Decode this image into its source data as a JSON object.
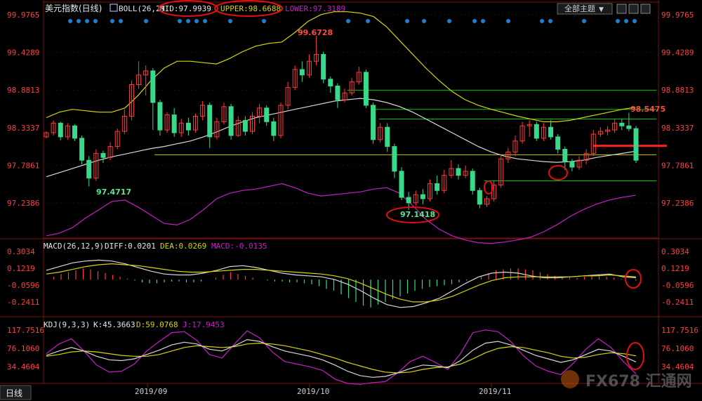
{
  "header": {
    "symbol": "美元指数",
    "period": "(日线)",
    "indicator": "BOLL(26,2)",
    "mid": "MID:97.9939",
    "upper": "UPPER:98.6688",
    "lower": "LOWER:97.3189",
    "theme_button": "全部主题"
  },
  "footer": {
    "tab": "日线"
  },
  "watermark": "FX678 汇通网",
  "colors": {
    "up": "#ff3b3b",
    "down": "#39d98a",
    "mid": "#d8d8d8",
    "upper": "#d6d600",
    "lower": "#c81ec8",
    "axis": "#ff4040",
    "level": "#c8c800",
    "support": "#00c800"
  },
  "chart_data": [
    {
      "type": "candlestick",
      "title": "美元指数(日线)",
      "indicator": "BOLL(26,2)",
      "yticks": [
        "99.9765",
        "99.4289",
        "98.8813",
        "98.3337",
        "97.7861",
        "97.2386"
      ],
      "ylim": [
        96.8,
        100.04
      ],
      "xticks": [
        "2019/09",
        "2019/10",
        "2019/11"
      ],
      "annotations": [
        {
          "text": "99.6728",
          "kind": "high"
        },
        {
          "text": "97.4717",
          "kind": "low"
        },
        {
          "text": "97.1418",
          "kind": "low"
        },
        {
          "text": "98.5475",
          "kind": "high"
        }
      ],
      "candles": [
        [
          98.2,
          98.26,
          98.28,
          98.18
        ],
        [
          98.26,
          98.4,
          98.44,
          98.22
        ],
        [
          98.4,
          98.2,
          98.42,
          98.15
        ],
        [
          98.2,
          98.36,
          98.4,
          98.16
        ],
        [
          98.36,
          98.18,
          98.38,
          98.14
        ],
        [
          98.18,
          97.86,
          98.22,
          97.8
        ],
        [
          97.86,
          97.6,
          97.92,
          97.48
        ],
        [
          97.6,
          97.96,
          98.02,
          97.56
        ],
        [
          97.96,
          97.9,
          98.0,
          97.82
        ],
        [
          97.9,
          98.06,
          98.12,
          97.86
        ],
        [
          98.06,
          98.28,
          98.32,
          98.02
        ],
        [
          98.28,
          98.5,
          98.6,
          98.24
        ],
        [
          98.5,
          98.96,
          99.02,
          98.44
        ],
        [
          98.96,
          99.1,
          99.3,
          98.9
        ],
        [
          99.1,
          99.16,
          99.24,
          98.8
        ],
        [
          99.16,
          98.7,
          99.2,
          98.3
        ],
        [
          98.7,
          98.3,
          98.74,
          98.22
        ],
        [
          98.3,
          98.52,
          98.56,
          98.26
        ],
        [
          98.52,
          98.26,
          98.62,
          98.2
        ],
        [
          98.26,
          98.4,
          98.46,
          98.2
        ],
        [
          98.4,
          98.3,
          98.48,
          98.22
        ],
        [
          98.3,
          98.5,
          98.54,
          98.26
        ],
        [
          98.5,
          98.66,
          98.72,
          98.44
        ],
        [
          98.66,
          98.2,
          98.7,
          98.04
        ],
        [
          98.2,
          98.42,
          98.48,
          98.16
        ],
        [
          98.42,
          98.64,
          98.7,
          98.38
        ],
        [
          98.64,
          98.22,
          98.68,
          98.16
        ],
        [
          98.22,
          98.44,
          98.5,
          98.2
        ],
        [
          98.44,
          98.28,
          98.5,
          98.22
        ],
        [
          98.28,
          98.5,
          98.56,
          98.24
        ],
        [
          98.5,
          98.62,
          98.68,
          98.4
        ],
        [
          98.62,
          98.42,
          98.66,
          98.36
        ],
        [
          98.42,
          98.22,
          98.48,
          98.14
        ],
        [
          98.22,
          98.66,
          98.7,
          98.18
        ],
        [
          98.66,
          98.92,
          99.0,
          98.6
        ],
        [
          98.92,
          99.18,
          99.24,
          98.88
        ],
        [
          99.18,
          99.1,
          99.3,
          99.0
        ],
        [
          99.1,
          99.3,
          99.4,
          99.06
        ],
        [
          99.3,
          99.4,
          99.67,
          99.24
        ],
        [
          99.4,
          99.04,
          99.44,
          98.98
        ],
        [
          99.04,
          98.94,
          99.08,
          98.84
        ],
        [
          98.94,
          98.74,
          98.98,
          98.62
        ],
        [
          98.74,
          98.84,
          98.9,
          98.7
        ],
        [
          98.84,
          99.0,
          99.06,
          98.8
        ],
        [
          99.0,
          99.14,
          99.22,
          98.96
        ],
        [
          99.14,
          98.66,
          99.18,
          98.62
        ],
        [
          98.66,
          98.16,
          98.7,
          98.1
        ],
        [
          98.16,
          98.34,
          98.4,
          98.12
        ],
        [
          98.34,
          98.06,
          98.4,
          97.98
        ],
        [
          98.06,
          97.7,
          98.1,
          97.6
        ],
        [
          97.7,
          97.32,
          97.76,
          97.28
        ],
        [
          97.32,
          97.24,
          97.4,
          97.14
        ],
        [
          97.24,
          97.36,
          97.42,
          97.2
        ],
        [
          97.36,
          97.3,
          97.44,
          97.22
        ],
        [
          97.3,
          97.52,
          97.58,
          97.26
        ],
        [
          97.52,
          97.42,
          97.64,
          97.36
        ],
        [
          97.42,
          97.64,
          97.72,
          97.38
        ],
        [
          97.64,
          97.74,
          97.86,
          97.6
        ],
        [
          97.74,
          97.64,
          97.8,
          97.58
        ],
        [
          97.64,
          97.7,
          97.78,
          97.6
        ],
        [
          97.7,
          97.42,
          97.74,
          97.36
        ],
        [
          97.42,
          97.22,
          97.46,
          97.16
        ],
        [
          97.22,
          97.3,
          97.34,
          97.18
        ],
        [
          97.3,
          97.5,
          97.56,
          97.26
        ],
        [
          97.5,
          97.88,
          97.94,
          97.46
        ],
        [
          97.88,
          97.98,
          98.04,
          97.82
        ],
        [
          97.98,
          98.14,
          98.22,
          97.92
        ],
        [
          98.14,
          98.36,
          98.42,
          98.1
        ],
        [
          98.36,
          98.38,
          98.44,
          98.2
        ],
        [
          98.38,
          98.18,
          98.42,
          98.14
        ],
        [
          98.18,
          98.34,
          98.4,
          98.14
        ],
        [
          98.34,
          98.2,
          98.44,
          98.16
        ],
        [
          98.2,
          98.02,
          98.24,
          97.96
        ],
        [
          98.02,
          97.84,
          98.06,
          97.72
        ],
        [
          97.84,
          97.76,
          97.88,
          97.7
        ],
        [
          97.76,
          97.86,
          97.92,
          97.72
        ],
        [
          97.86,
          97.96,
          98.02,
          97.8
        ],
        [
          97.96,
          98.24,
          98.3,
          97.92
        ],
        [
          98.24,
          98.28,
          98.34,
          98.2
        ],
        [
          98.28,
          98.3,
          98.36,
          98.22
        ],
        [
          98.3,
          98.4,
          98.46,
          98.26
        ],
        [
          98.4,
          98.36,
          98.46,
          98.3
        ],
        [
          98.36,
          98.32,
          98.55,
          98.28
        ],
        [
          98.32,
          97.86,
          98.36,
          97.82
        ]
      ],
      "boll": {
        "mid": [
          97.62,
          97.68,
          97.74,
          97.8,
          97.86,
          97.91,
          97.95,
          97.99,
          98.03,
          98.06,
          98.1,
          98.14,
          98.2,
          98.27,
          98.35,
          98.42,
          98.48,
          98.52,
          98.56,
          98.6,
          98.64,
          98.68,
          98.72,
          98.74,
          98.76,
          98.74,
          98.7,
          98.64,
          98.56,
          98.46,
          98.36,
          98.26,
          98.16,
          98.06,
          97.98,
          97.92,
          97.88,
          97.86,
          97.84,
          97.83,
          97.84,
          97.86,
          97.9,
          97.93,
          97.96,
          97.99
        ],
        "upper": [
          98.48,
          98.56,
          98.6,
          98.58,
          98.56,
          98.56,
          98.62,
          98.8,
          99.02,
          99.2,
          99.3,
          99.3,
          99.28,
          99.26,
          99.34,
          99.44,
          99.52,
          99.56,
          99.58,
          99.72,
          99.88,
          99.98,
          100.02,
          100.02,
          100.0,
          99.95,
          99.8,
          99.6,
          99.4,
          99.2,
          99.02,
          98.86,
          98.74,
          98.66,
          98.6,
          98.55,
          98.5,
          98.46,
          98.42,
          98.42,
          98.44,
          98.48,
          98.52,
          98.56,
          98.6,
          98.63
        ],
        "lower": [
          96.76,
          96.8,
          96.88,
          97.02,
          97.14,
          97.26,
          97.28,
          97.18,
          97.06,
          96.94,
          96.92,
          97.0,
          97.14,
          97.3,
          97.38,
          97.42,
          97.44,
          97.48,
          97.52,
          97.46,
          97.38,
          97.34,
          97.36,
          97.38,
          97.4,
          97.44,
          97.46,
          97.38,
          97.2,
          97.0,
          96.86,
          96.76,
          96.7,
          96.66,
          96.65,
          96.67,
          96.7,
          96.74,
          96.82,
          96.92,
          97.04,
          97.14,
          97.22,
          97.28,
          97.32,
          97.35
        ]
      },
      "levels": {
        "horizontal_yellow": 97.94,
        "support_lines": [
          98.88,
          98.6,
          98.46,
          97.56
        ],
        "red_line": 98.07
      }
    },
    {
      "type": "line",
      "title": "MACD(26,12,9)",
      "legend": [
        "DIFF:0.0201",
        "DEA:0.0269",
        "MACD:-0.0135"
      ],
      "yticks": [
        "0.3034",
        "0.1219",
        "-0.0596",
        "-0.2411"
      ],
      "ylim": [
        -0.4,
        0.38
      ],
      "macd_bars": [
        0.0,
        0.03,
        0.06,
        0.08,
        0.1,
        0.12,
        0.11,
        0.09,
        0.07,
        0.05,
        0.03,
        0.01,
        -0.01,
        -0.03,
        -0.04,
        -0.04,
        -0.03,
        -0.02,
        -0.02,
        -0.03,
        -0.03,
        -0.02,
        0.0,
        0.02,
        0.05,
        0.08,
        0.06,
        0.04,
        0.02,
        0.0,
        -0.01,
        -0.02,
        -0.02,
        -0.03,
        -0.03,
        -0.04,
        -0.05,
        -0.07,
        -0.1,
        -0.12,
        -0.16,
        -0.2,
        -0.24,
        -0.28,
        -0.3,
        -0.27,
        -0.24,
        -0.21,
        -0.18,
        -0.15,
        -0.12,
        -0.1,
        -0.08,
        -0.07,
        -0.06,
        -0.05,
        -0.03,
        -0.01,
        0.01,
        0.04,
        0.07,
        0.1,
        0.11,
        0.12,
        0.12,
        0.11,
        0.1,
        0.08,
        0.06,
        0.04,
        0.03,
        0.02,
        0.02,
        0.03,
        0.04,
        0.04,
        0.03,
        0.02,
        0.01,
        0.0,
        -0.01
      ],
      "diff": [
        0.1,
        0.14,
        0.18,
        0.2,
        0.21,
        0.2,
        0.17,
        0.13,
        0.09,
        0.06,
        0.05,
        0.05,
        0.07,
        0.1,
        0.14,
        0.15,
        0.13,
        0.1,
        0.07,
        0.05,
        0.04,
        0.03,
        0.0,
        -0.05,
        -0.12,
        -0.2,
        -0.27,
        -0.3,
        -0.29,
        -0.25,
        -0.2,
        -0.12,
        -0.04,
        0.03,
        0.07,
        0.08,
        0.07,
        0.04,
        0.02,
        0.02,
        0.03,
        0.04,
        0.05,
        0.06,
        0.03,
        0.02
      ],
      "dea": [
        0.06,
        0.08,
        0.11,
        0.14,
        0.16,
        0.17,
        0.16,
        0.15,
        0.13,
        0.11,
        0.09,
        0.08,
        0.08,
        0.09,
        0.1,
        0.11,
        0.11,
        0.1,
        0.09,
        0.08,
        0.07,
        0.06,
        0.04,
        0.01,
        -0.04,
        -0.1,
        -0.16,
        -0.21,
        -0.24,
        -0.24,
        -0.22,
        -0.18,
        -0.12,
        -0.06,
        -0.01,
        0.02,
        0.03,
        0.03,
        0.03,
        0.03,
        0.03,
        0.04,
        0.04,
        0.05,
        0.04,
        0.03
      ]
    },
    {
      "type": "line",
      "title": "KDJ(9,3,3)",
      "legend": [
        "K:45.3663",
        "D:59.0768",
        "J:17.9453"
      ],
      "yticks": [
        "117.7516",
        "76.1060",
        "34.4604"
      ],
      "ylim": [
        0,
        125
      ],
      "k": [
        60,
        70,
        78,
        70,
        58,
        50,
        48,
        52,
        62,
        72,
        84,
        90,
        86,
        74,
        70,
        82,
        96,
        92,
        80,
        70,
        64,
        58,
        50,
        38,
        24,
        14,
        10,
        12,
        20,
        30,
        38,
        36,
        32,
        48,
        72,
        88,
        92,
        84,
        72,
        60,
        52,
        44,
        50,
        62,
        74,
        70,
        58,
        45
      ],
      "d": [
        58,
        62,
        68,
        70,
        68,
        64,
        60,
        58,
        58,
        62,
        70,
        78,
        82,
        80,
        78,
        80,
        86,
        88,
        86,
        82,
        76,
        70,
        62,
        54,
        44,
        36,
        28,
        22,
        20,
        22,
        28,
        32,
        34,
        40,
        52,
        66,
        76,
        80,
        78,
        72,
        66,
        58,
        54,
        56,
        62,
        66,
        64,
        59
      ],
      "j": [
        64,
        86,
        98,
        70,
        38,
        22,
        24,
        40,
        70,
        92,
        112,
        114,
        94,
        62,
        54,
        86,
        116,
        100,
        68,
        46,
        40,
        34,
        26,
        6,
        -4,
        -6,
        -2,
        0,
        20,
        46,
        58,
        44,
        28,
        64,
        112,
        118,
        114,
        92,
        60,
        36,
        24,
        16,
        42,
        74,
        98,
        78,
        46,
        18
      ]
    }
  ]
}
